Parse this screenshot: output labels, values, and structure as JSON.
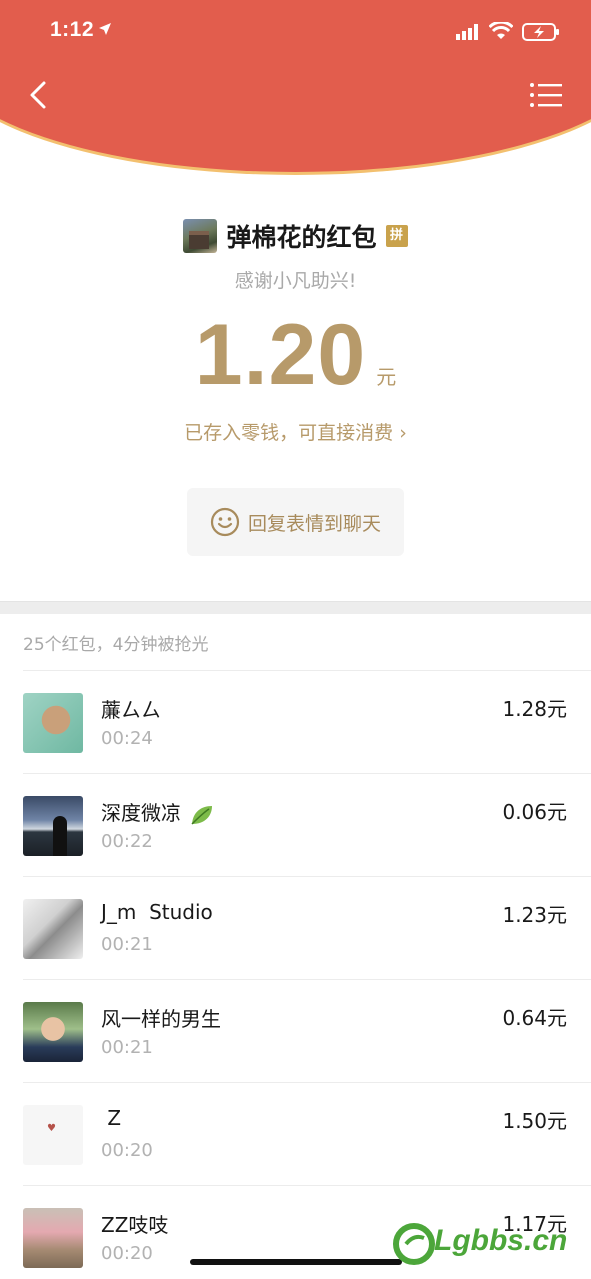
{
  "status_bar": {
    "time": "1:12"
  },
  "header": {
    "back_icon": "chevron-left-icon",
    "menu_icon": "list-icon"
  },
  "sender": {
    "name": "弹棉花的红包",
    "pin_badge": "拼",
    "greeting": "感谢小凡助兴!"
  },
  "amount": {
    "value": "1.20",
    "unit": "元",
    "saved_text": "已存入零钱，可直接消费 ›"
  },
  "reply_button": {
    "label": "回复表情到聊天",
    "icon": "smiley-icon"
  },
  "summary": "25个红包，4分钟被抢光",
  "records": [
    {
      "name": "薕ㄙㄙ",
      "time": "00:24",
      "amount": "1.28元"
    },
    {
      "name": "深度微凉",
      "time": "00:22",
      "amount": "0.06元"
    },
    {
      "name": "J_m  Studio",
      "time": "00:21",
      "amount": "1.23元"
    },
    {
      "name": "风一样的男生",
      "time": "00:21",
      "amount": "0.64元"
    },
    {
      "name": " Z",
      "time": "00:20",
      "amount": "1.50元"
    },
    {
      "name": "ZZ吱吱",
      "time": "00:20",
      "amount": "1.17元"
    }
  ],
  "watermark": "Lgbbs.cn",
  "colors": {
    "header_red": "#e25d4d",
    "gold": "#b79a6a",
    "header_rim": "#f3c06f"
  }
}
